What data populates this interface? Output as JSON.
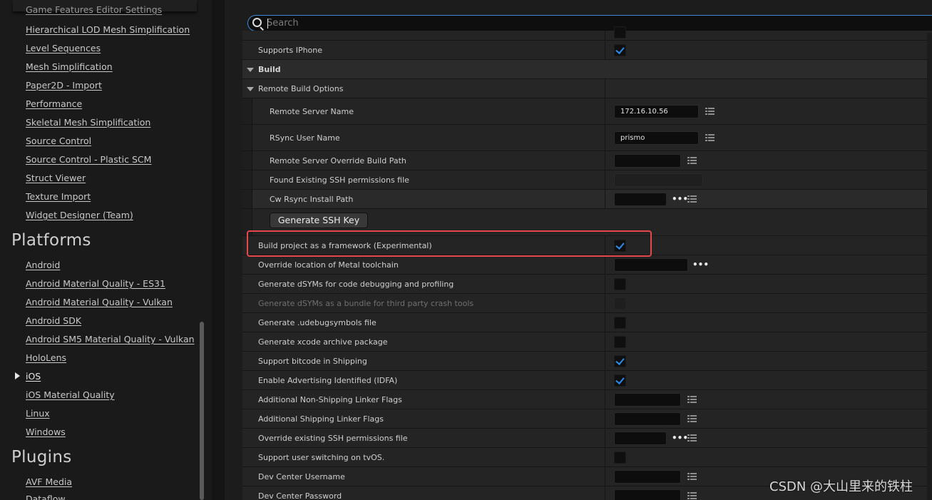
{
  "sidebar": {
    "partial_top_item": "Game Features Editor Settings",
    "editor_items": [
      {
        "label": "Hierarchical LOD Mesh Simplification"
      },
      {
        "label": "Level Sequences"
      },
      {
        "label": "Mesh Simplification"
      },
      {
        "label": "Paper2D - Import"
      },
      {
        "label": "Performance"
      },
      {
        "label": "Skeletal Mesh Simplification"
      },
      {
        "label": "Source Control"
      },
      {
        "label": "Source Control - Plastic SCM"
      },
      {
        "label": "Struct Viewer"
      },
      {
        "label": "Texture Import"
      },
      {
        "label": "Widget Designer (Team)"
      }
    ],
    "platforms_title": "Platforms",
    "platform_items": [
      {
        "label": "Android"
      },
      {
        "label": "Android Material Quality - ES31"
      },
      {
        "label": "Android Material Quality - Vulkan"
      },
      {
        "label": "Android SDK"
      },
      {
        "label": "Android SM5 Material Quality - Vulkan"
      },
      {
        "label": "HoloLens"
      },
      {
        "label": "iOS",
        "selected": true
      },
      {
        "label": "iOS Material Quality"
      },
      {
        "label": "Linux"
      },
      {
        "label": "Windows"
      }
    ],
    "plugins_title": "Plugins",
    "plugin_items": [
      {
        "label": "AVF Media"
      },
      {
        "label": "Dataflow"
      }
    ]
  },
  "search": {
    "placeholder": "Search"
  },
  "properties": {
    "supports_iphone": {
      "label": "Supports IPhone",
      "checked": true
    },
    "build_header": "Build",
    "remote_build_header": "Remote Build Options",
    "remote_server_name": {
      "label": "Remote Server Name",
      "value": "172.16.10.56"
    },
    "rsync_user_name": {
      "label": "RSync User Name",
      "value": "prismo"
    },
    "remote_server_override_build_path": {
      "label": "Remote Server Override Build Path",
      "value": ""
    },
    "found_existing_ssh": {
      "label": "Found Existing SSH permissions file",
      "value": ""
    },
    "cw_rsync_install_path": {
      "label": "Cw Rsync Install Path",
      "value": ""
    },
    "generate_ssh_key_button": "Generate SSH Key",
    "build_as_framework": {
      "label": "Build project as a framework (Experimental)",
      "checked": true
    },
    "override_metal_toolchain": {
      "label": "Override location of Metal toolchain",
      "value": ""
    },
    "generate_dsyms": {
      "label": "Generate dSYMs for code debugging and profiling",
      "checked": false
    },
    "generate_dsyms_bundle": {
      "label": "Generate dSYMs as a bundle for third party crash tools",
      "checked": false,
      "disabled": true
    },
    "generate_udebugsymbols": {
      "label": "Generate .udebugsymbols file",
      "checked": false
    },
    "generate_xcode_archive": {
      "label": "Generate xcode archive package",
      "checked": false
    },
    "support_bitcode": {
      "label": "Support bitcode in Shipping",
      "checked": true
    },
    "enable_idfa": {
      "label": "Enable Advertising Identified (IDFA)",
      "checked": true
    },
    "additional_non_shipping_flags": {
      "label": "Additional Non-Shipping Linker Flags",
      "value": ""
    },
    "additional_shipping_flags": {
      "label": "Additional Shipping Linker Flags",
      "value": ""
    },
    "override_ssh_permissions": {
      "label": "Override existing SSH permissions file",
      "value": ""
    },
    "support_user_switching_tvos": {
      "label": "Support user switching on tvOS.",
      "checked": false
    },
    "dev_center_username": {
      "label": "Dev Center Username",
      "value": ""
    },
    "dev_center_password": {
      "label": "Dev Center Password",
      "value": ""
    }
  },
  "watermark": "CSDN @大山里来的铁柱",
  "colors": {
    "accent": "#2a8cf0",
    "highlight_box": "#e5474a",
    "search_border": "#3d8ad6"
  }
}
